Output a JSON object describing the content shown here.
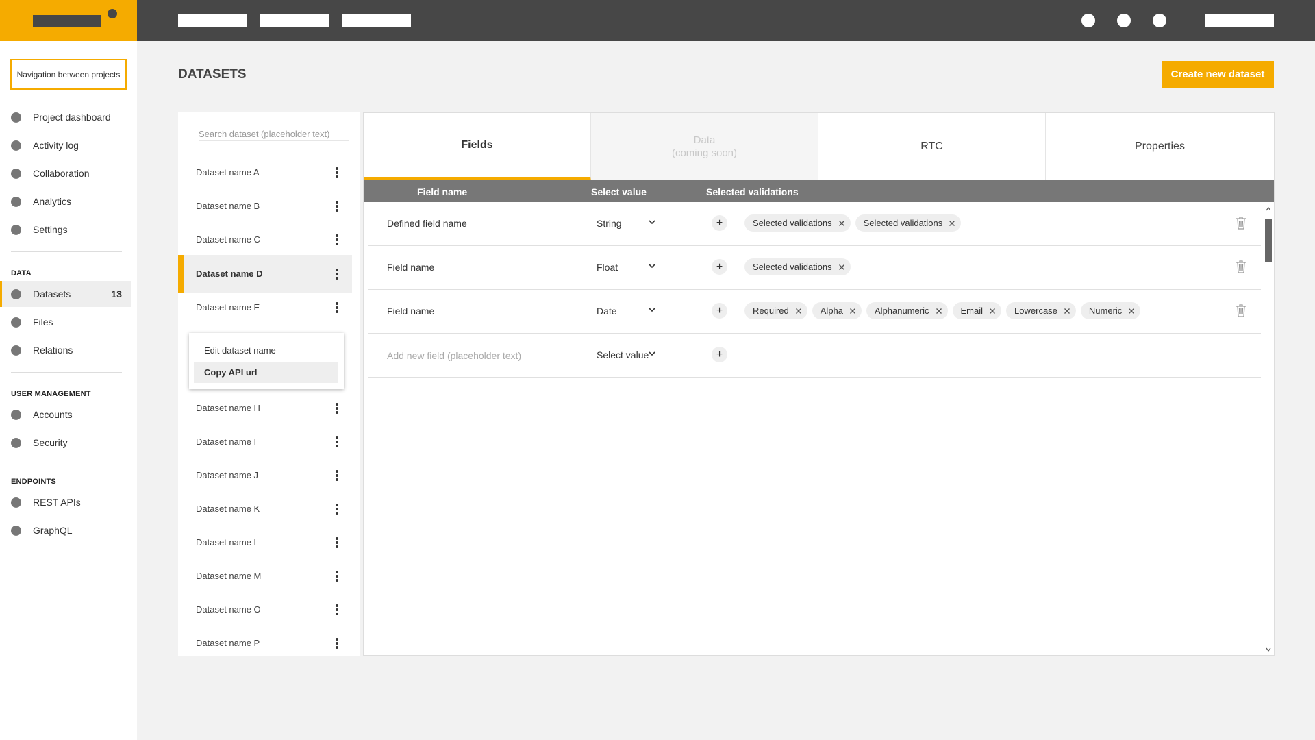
{
  "topbar": {
    "brand_color": "#f5ab00",
    "bar_color": "#474747"
  },
  "sidebar": {
    "project_nav": "Navigation between projects",
    "main_items": [
      {
        "label": "Project dashboard",
        "icon": "circle-icon"
      },
      {
        "label": "Activity log",
        "icon": "circle-icon"
      },
      {
        "label": "Collaboration",
        "icon": "circle-icon"
      },
      {
        "label": "Analytics",
        "icon": "circle-icon"
      },
      {
        "label": "Settings",
        "icon": "circle-icon"
      }
    ],
    "data_heading": "DATA",
    "data_items": [
      {
        "label": "Datasets",
        "count": "13",
        "active": true
      },
      {
        "label": "Files"
      },
      {
        "label": "Relations"
      }
    ],
    "user_heading": "USER MANAGEMENT",
    "user_items": [
      {
        "label": "Accounts"
      },
      {
        "label": "Security"
      }
    ],
    "endpoints_heading": "ENDPOINTS",
    "endpoint_items": [
      {
        "label": "REST APIs"
      },
      {
        "label": "GraphQL"
      }
    ]
  },
  "main": {
    "title": "DATASETS",
    "create_button": "Create new dataset"
  },
  "datasets": {
    "search_placeholder": "Search dataset (placeholder text)",
    "items": [
      "Dataset name A",
      "Dataset name B",
      "Dataset name C",
      "Dataset name D",
      "Dataset name E",
      "Dataset name H",
      "Dataset name I",
      "Dataset name J",
      "Dataset name K",
      "Dataset name L",
      "Dataset name M",
      "Dataset name O",
      "Dataset name P"
    ],
    "selected": "Dataset name D",
    "context_menu": {
      "edit": "Edit dataset name",
      "copy": "Copy API url"
    }
  },
  "tabs": {
    "fields": "Fields",
    "data": "Data\n(coming soon)",
    "rtc": "RTC",
    "properties": "Properties"
  },
  "table": {
    "headers": {
      "field_name": "Field name",
      "select_value": "Select value",
      "validations": "Selected validations"
    },
    "rows": [
      {
        "name": "Defined field name",
        "type": "String",
        "validations": [
          "Selected validations",
          "Selected validations"
        ]
      },
      {
        "name": "Field name",
        "type": "Float",
        "validations": [
          "Selected validations"
        ]
      },
      {
        "name": "Field name",
        "type": "Date",
        "validations": [
          "Required",
          "Alpha",
          "Alphanumeric",
          "Email",
          "Lowercase",
          "Numeric"
        ]
      }
    ],
    "new_field_placeholder": "Add new field (placeholder text)",
    "new_field_type": "Select value"
  }
}
